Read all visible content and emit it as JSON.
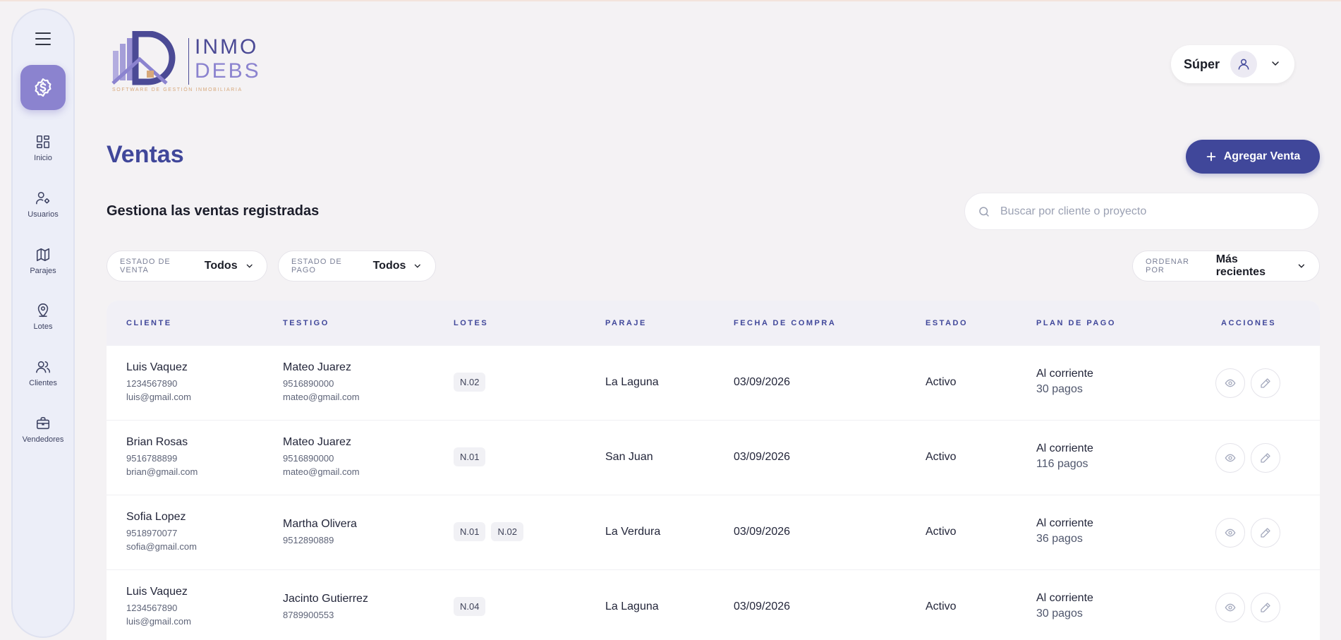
{
  "sidebar": {
    "items": [
      {
        "label": "Inicio",
        "icon": "grid-icon"
      },
      {
        "label": "Usuarios",
        "icon": "user-settings-icon"
      },
      {
        "label": "Parajes",
        "icon": "map-icon"
      },
      {
        "label": "Lotes",
        "icon": "map-pin-icon"
      },
      {
        "label": "Clientes",
        "icon": "users-icon"
      },
      {
        "label": "Vendedores",
        "icon": "briefcase-icon"
      }
    ]
  },
  "logo": {
    "line1": "INMO",
    "line2": "DEBS",
    "tagline": "SOFTWARE DE GESTIÓN INMOBILIARIA"
  },
  "user": {
    "name": "Súper"
  },
  "header": {
    "title": "Ventas",
    "add_label": "Agregar Venta",
    "subtitle": "Gestiona las ventas registradas"
  },
  "search": {
    "placeholder": "Buscar por cliente o proyecto"
  },
  "filters": {
    "estado_venta": {
      "label": "ESTADO DE VENTA",
      "value": "Todos"
    },
    "estado_pago": {
      "label": "ESTADO DE PAGO",
      "value": "Todos"
    },
    "ordenar": {
      "label": "ORDENAR POR",
      "value": "Más recientes"
    }
  },
  "table": {
    "columns": [
      "CLIENTE",
      "TESTIGO",
      "LOTES",
      "PARAJE",
      "FECHA DE COMPRA",
      "ESTADO",
      "PLAN DE PAGO",
      "ACCIONES"
    ],
    "rows": [
      {
        "cliente": {
          "name": "Luis Vaquez",
          "phone": "1234567890",
          "email": "luis@gmail.com"
        },
        "testigo": {
          "name": "Mateo Juarez",
          "phone": "9516890000",
          "email": "mateo@gmail.com"
        },
        "lotes": [
          "N.02"
        ],
        "paraje": "La Laguna",
        "fecha": "03/09/2026",
        "estado": "Activo",
        "plan": {
          "status": "Al corriente",
          "pagos": "30 pagos"
        }
      },
      {
        "cliente": {
          "name": "Brian Rosas",
          "phone": "9516788899",
          "email": "brian@gmail.com"
        },
        "testigo": {
          "name": "Mateo Juarez",
          "phone": "9516890000",
          "email": "mateo@gmail.com"
        },
        "lotes": [
          "N.01"
        ],
        "paraje": "San Juan",
        "fecha": "03/09/2026",
        "estado": "Activo",
        "plan": {
          "status": "Al corriente",
          "pagos": "116 pagos"
        }
      },
      {
        "cliente": {
          "name": "Sofia Lopez",
          "phone": "9518970077",
          "email": "sofia@gmail.com"
        },
        "testigo": {
          "name": "Martha Olivera",
          "phone": "9512890889",
          "email": ""
        },
        "lotes": [
          "N.01",
          "N.02"
        ],
        "paraje": "La Verdura",
        "fecha": "03/09/2026",
        "estado": "Activo",
        "plan": {
          "status": "Al corriente",
          "pagos": "36 pagos"
        }
      },
      {
        "cliente": {
          "name": "Luis Vaquez",
          "phone": "1234567890",
          "email": "luis@gmail.com"
        },
        "testigo": {
          "name": "Jacinto Gutierrez",
          "phone": "8789900553",
          "email": ""
        },
        "lotes": [
          "N.04"
        ],
        "paraje": "La Laguna",
        "fecha": "03/09/2026",
        "estado": "Activo",
        "plan": {
          "status": "Al corriente",
          "pagos": "30 pagos"
        }
      }
    ]
  },
  "colors": {
    "primary": "#40479a",
    "accent": "#8b83cf",
    "background": "#f4f2f4"
  }
}
